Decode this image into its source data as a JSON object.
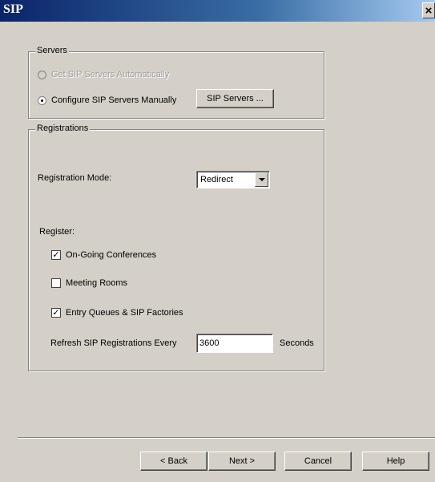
{
  "window": {
    "title": "SIP",
    "close_glyph": "×"
  },
  "servers": {
    "group_label": "Servers",
    "options": [
      {
        "label": "Get SIP Servers Automatically",
        "checked": false,
        "disabled": true
      },
      {
        "label": "Configure SIP Servers Manually",
        "checked": true,
        "disabled": false
      }
    ],
    "sip_servers_button": "SIP Servers ..."
  },
  "registrations": {
    "group_label": "Registrations",
    "mode_label": "Registration Mode:",
    "mode_value": "Redirect",
    "register_label": "Register:",
    "checkboxes": [
      {
        "label": "On-Going Conferences",
        "checked": true
      },
      {
        "label": "Meeting Rooms",
        "checked": false
      },
      {
        "label": "Entry Queues & SIP Factories",
        "checked": true
      }
    ],
    "refresh_label": "Refresh SIP Registrations Every",
    "refresh_value": "3600",
    "refresh_units": "Seconds"
  },
  "footer": {
    "back": "< Back",
    "next": "Next >",
    "cancel": "Cancel",
    "help": "Help"
  },
  "icons": {
    "close": "close-icon",
    "dropdown": "chevron-down-icon",
    "check": "check-icon"
  }
}
